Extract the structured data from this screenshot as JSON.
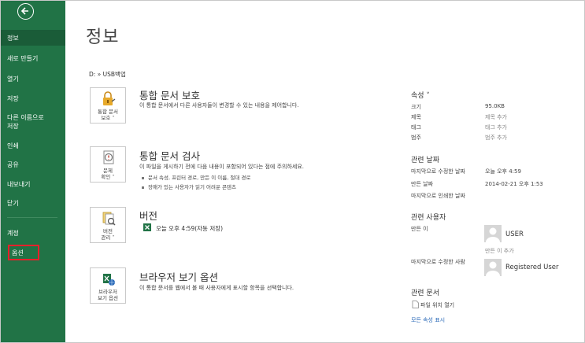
{
  "sidebar": {
    "items": [
      {
        "label": "정보"
      },
      {
        "label": "새로 만들기"
      },
      {
        "label": "열기"
      },
      {
        "label": "저장"
      },
      {
        "label": "다른 이름으로\n저장"
      },
      {
        "label": "인쇄"
      },
      {
        "label": "공유"
      },
      {
        "label": "내보내기"
      },
      {
        "label": "닫기"
      },
      {
        "label": "계정"
      },
      {
        "label": "옵션"
      }
    ]
  },
  "main": {
    "title": "정보",
    "path": "D: » USB백업",
    "protect": {
      "tile_label": "통합 문서\n보호 ˅",
      "title": "통합 문서 보호",
      "desc": "이 통합 문서에서 다른 사용자들이 변경할 수 있는 내용을 제어합니다."
    },
    "inspect": {
      "tile_label": "문제\n확인 ˅",
      "title": "통합 문서 검사",
      "desc": "이 파일을 게시하기 전에 다음 내용이 포함되어 있다는 점에 주의하세요.",
      "bullets": [
        "문서 속성, 프린터 경로, 만든 이 이름, 절대 경로",
        "장애가 있는 사용자가 읽기 어려운 콘텐츠"
      ]
    },
    "versions": {
      "tile_label": "버전\n관리 ˅",
      "title": "버전",
      "entry": "오늘 오후 4:59(자동 저장)"
    },
    "browser": {
      "tile_label": "브라우저\n보기 옵션",
      "title": "브라우저 보기 옵션",
      "desc": "이 통합 문서를 웹에서 볼 때 사용자에게 표시할 항목을 선택합니다."
    }
  },
  "properties": {
    "header": "속성 ˅",
    "rows": [
      {
        "label": "크기",
        "value": "95.0KB"
      },
      {
        "label": "제목",
        "value": "제목 추가"
      },
      {
        "label": "태그",
        "value": "태그 추가"
      },
      {
        "label": "범주",
        "value": "범주 추가"
      }
    ]
  },
  "dates": {
    "header": "관련 날짜",
    "rows": [
      {
        "label": "마지막으로 수정한 날짜",
        "value": "오늘 오후 4:59"
      },
      {
        "label": "만든 날짜",
        "value": "2014-02-21 오후 1:53"
      },
      {
        "label": "마지막으로 인쇄한 날짜",
        "value": ""
      }
    ]
  },
  "people": {
    "header": "관련 사용자",
    "author_label": "만든 이",
    "author_name": "USER",
    "add_author": "만든 이 추가",
    "modified_label": "마지막으로 수정한 사람",
    "modified_name": "Registered User"
  },
  "documents": {
    "header": "관련 문서",
    "open_location": "파일 위치 열기",
    "show_all": "모든 속성 표시"
  },
  "colors": {
    "sidebar_bg": "#217346",
    "highlight_border": "#e8202a",
    "link": "#2b6ab8"
  }
}
